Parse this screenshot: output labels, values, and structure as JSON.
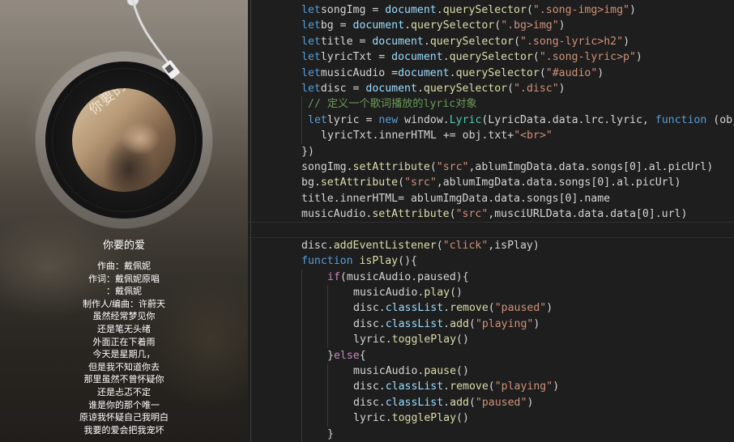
{
  "preview": {
    "song_title": "你要的爱",
    "cover_text": "你要的爱",
    "lyrics": [
      "作曲：戴佩妮",
      "作词：戴佩妮原唱",
      "：戴佩妮",
      "制作人/编曲：许蔚天",
      "虽然经常梦见你",
      "还是笔无头绪",
      "外面正在下着雨",
      "今天是星期几，",
      "但是我不知道你去",
      "那里虽然不曾怀疑你",
      "还是忐忑不定",
      "谁是你的那个唯一",
      "原谅我怀疑自己我明白",
      "我要的爱会把我宠坏"
    ]
  },
  "editor": {
    "lines": [
      {
        "indent": 4,
        "tokens": [
          [
            "kw",
            "let"
          ],
          [
            "",
            "songImg = "
          ],
          [
            "var",
            "document"
          ],
          [
            "",
            "."
          ],
          [
            "fn",
            "querySelector"
          ],
          [
            "",
            "("
          ],
          [
            "str",
            "\".song-img>img\""
          ],
          [
            "",
            ")"
          ]
        ]
      },
      {
        "indent": 4,
        "tokens": [
          [
            "kw",
            "let"
          ],
          [
            "",
            "bg = "
          ],
          [
            "var",
            "document"
          ],
          [
            "",
            "."
          ],
          [
            "fn",
            "querySelector"
          ],
          [
            "",
            "("
          ],
          [
            "str",
            "\".bg>img\""
          ],
          [
            "",
            ")"
          ]
        ]
      },
      {
        "indent": 4,
        "tokens": [
          [
            "kw",
            "let"
          ],
          [
            "",
            "title = "
          ],
          [
            "var",
            "document"
          ],
          [
            "",
            "."
          ],
          [
            "fn",
            "querySelector"
          ],
          [
            "",
            "("
          ],
          [
            "str",
            "\".song-lyric>h2\""
          ],
          [
            "",
            ")"
          ]
        ]
      },
      {
        "indent": 4,
        "tokens": [
          [
            "kw",
            "let"
          ],
          [
            "",
            "lyricTxt = "
          ],
          [
            "var",
            "document"
          ],
          [
            "",
            "."
          ],
          [
            "fn",
            "querySelector"
          ],
          [
            "",
            "("
          ],
          [
            "str",
            "\".song-lyric>p\""
          ],
          [
            "",
            ")"
          ]
        ]
      },
      {
        "indent": 4,
        "tokens": [
          [
            "kw",
            "let"
          ],
          [
            "",
            "musicAudio ="
          ],
          [
            "var",
            "document"
          ],
          [
            "",
            "."
          ],
          [
            "fn",
            "querySelector"
          ],
          [
            "",
            "("
          ],
          [
            "str",
            "\"#audio\""
          ],
          [
            "",
            ")"
          ]
        ]
      },
      {
        "indent": 4,
        "tokens": [
          [
            "kw",
            "let"
          ],
          [
            "",
            "disc = "
          ],
          [
            "var",
            "document"
          ],
          [
            "",
            "."
          ],
          [
            "fn",
            "querySelector"
          ],
          [
            "",
            "("
          ],
          [
            "str",
            "\".disc\""
          ],
          [
            "",
            ")"
          ]
        ]
      },
      {
        "indent": 5,
        "tokens": [
          [
            "cmt",
            "// 定义一个歌词播放的lyric对象"
          ]
        ]
      },
      {
        "indent": 5,
        "tokens": [
          [
            "kw",
            "let"
          ],
          [
            "",
            "lyric = "
          ],
          [
            "kw",
            "new"
          ],
          [
            "",
            " window."
          ],
          [
            "cls",
            "Lyric"
          ],
          [
            "",
            "(LyricData.data.lrc.lyric, "
          ],
          [
            "kw",
            "function"
          ],
          [
            "",
            " (obj) {"
          ]
        ]
      },
      {
        "indent": 7,
        "tokens": [
          [
            "",
            "lyricTxt.innerHTML += obj.txt+"
          ],
          [
            "str",
            "\"<br>\""
          ]
        ]
      },
      {
        "indent": 4,
        "tokens": [
          [
            "",
            "})"
          ]
        ]
      },
      {
        "indent": 4,
        "tokens": [
          [
            "",
            "songImg."
          ],
          [
            "fn",
            "setAttribute"
          ],
          [
            "",
            "("
          ],
          [
            "str",
            "\"src\""
          ],
          [
            "",
            ",ablumImgData.data.songs[0].al.picUrl)"
          ]
        ]
      },
      {
        "indent": 4,
        "tokens": [
          [
            "",
            "bg."
          ],
          [
            "fn",
            "setAttribute"
          ],
          [
            "",
            "("
          ],
          [
            "str",
            "\"src\""
          ],
          [
            "",
            ",ablumImgData.data.songs[0].al.picUrl)"
          ]
        ]
      },
      {
        "indent": 4,
        "tokens": [
          [
            "",
            "title.innerHTML= ablumImgData.data.songs[0].name"
          ]
        ]
      },
      {
        "indent": 4,
        "tokens": [
          [
            "",
            "musicAudio."
          ],
          [
            "fn",
            "setAttribute"
          ],
          [
            "",
            "("
          ],
          [
            "str",
            "\"src\""
          ],
          [
            "",
            ",musciURLData.data.data[0].url)"
          ]
        ]
      },
      {
        "indent": 0,
        "cursor": true,
        "tokens": []
      },
      {
        "indent": 4,
        "tokens": [
          [
            "",
            "disc."
          ],
          [
            "fn",
            "addEventListener"
          ],
          [
            "",
            "("
          ],
          [
            "str",
            "\"click\""
          ],
          [
            "",
            ",isPlay)"
          ]
        ]
      },
      {
        "indent": 4,
        "tokens": [
          [
            "kw",
            "function"
          ],
          [
            "",
            " "
          ],
          [
            "fn",
            "isPlay"
          ],
          [
            "",
            "(){"
          ]
        ]
      },
      {
        "indent": 8,
        "tokens": [
          [
            "ctl",
            "if"
          ],
          [
            "",
            "(musicAudio.paused){"
          ]
        ]
      },
      {
        "indent": 12,
        "tokens": [
          [
            "",
            "musicAudio."
          ],
          [
            "fn",
            "play"
          ],
          [
            "",
            "()"
          ]
        ]
      },
      {
        "indent": 12,
        "tokens": [
          [
            "",
            "disc."
          ],
          [
            "var",
            "classList"
          ],
          [
            "",
            "."
          ],
          [
            "fn",
            "remove"
          ],
          [
            "",
            "("
          ],
          [
            "str",
            "\"paused\""
          ],
          [
            "",
            ")"
          ]
        ]
      },
      {
        "indent": 12,
        "tokens": [
          [
            "",
            "disc."
          ],
          [
            "var",
            "classList"
          ],
          [
            "",
            "."
          ],
          [
            "fn",
            "add"
          ],
          [
            "",
            "("
          ],
          [
            "str",
            "\"playing\""
          ],
          [
            "",
            ")"
          ]
        ]
      },
      {
        "indent": 12,
        "tokens": [
          [
            "",
            "lyric."
          ],
          [
            "fn",
            "togglePlay"
          ],
          [
            "",
            "()"
          ]
        ]
      },
      {
        "indent": 8,
        "tokens": [
          [
            "",
            "}"
          ],
          [
            "ctl",
            "else"
          ],
          [
            "",
            "{"
          ]
        ]
      },
      {
        "indent": 12,
        "tokens": [
          [
            "",
            "musicAudio."
          ],
          [
            "fn",
            "pause"
          ],
          [
            "",
            "()"
          ]
        ]
      },
      {
        "indent": 12,
        "tokens": [
          [
            "",
            "disc."
          ],
          [
            "var",
            "classList"
          ],
          [
            "",
            "."
          ],
          [
            "fn",
            "remove"
          ],
          [
            "",
            "("
          ],
          [
            "str",
            "\"playing\""
          ],
          [
            "",
            ")"
          ]
        ]
      },
      {
        "indent": 12,
        "tokens": [
          [
            "",
            "disc."
          ],
          [
            "var",
            "classList"
          ],
          [
            "",
            "."
          ],
          [
            "fn",
            "add"
          ],
          [
            "",
            "("
          ],
          [
            "str",
            "\"paused\""
          ],
          [
            "",
            ")"
          ]
        ]
      },
      {
        "indent": 12,
        "tokens": [
          [
            "",
            "lyric."
          ],
          [
            "fn",
            "togglePlay"
          ],
          [
            "",
            "()"
          ]
        ]
      },
      {
        "indent": 8,
        "tokens": [
          [
            "",
            "}"
          ]
        ]
      }
    ]
  }
}
